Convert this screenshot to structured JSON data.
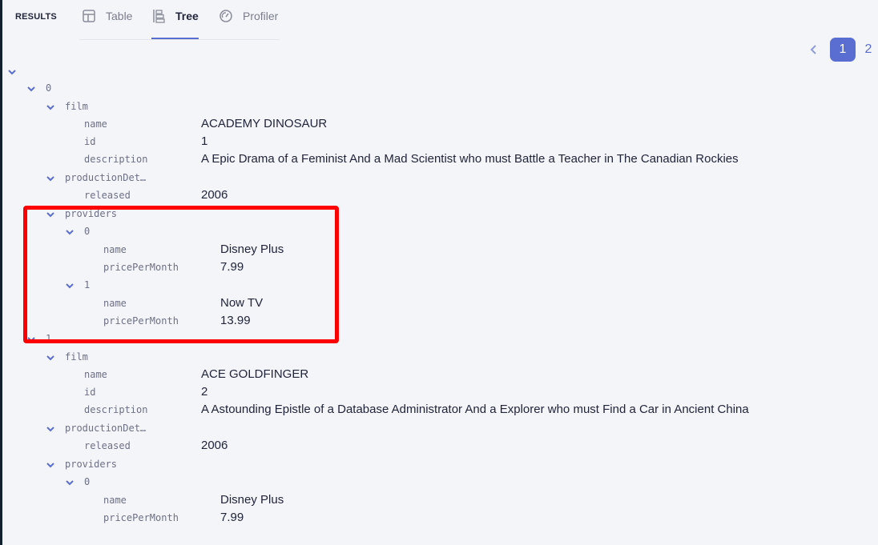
{
  "header": {
    "section_label": "RESULTS",
    "tabs": [
      {
        "label": "Table",
        "icon": "table-icon",
        "active": false
      },
      {
        "label": "Tree",
        "icon": "tree-icon",
        "active": true
      },
      {
        "label": "Profiler",
        "icon": "gauge-icon",
        "active": false
      }
    ]
  },
  "pagination": {
    "prev_icon": "chevron-left-icon",
    "pages": [
      "1",
      "2"
    ],
    "current_page": "1"
  },
  "tree": {
    "root_toggle": "expanded",
    "documents": [
      {
        "index": "0",
        "film_key": "film",
        "film": {
          "name_key": "name",
          "name": "ACADEMY DINOSAUR",
          "id_key": "id",
          "id": "1",
          "description_key": "description",
          "description": "A Epic Drama of a Feminist And a Mad Scientist who must Battle a Teacher in The Canadian Rockies"
        },
        "production_key": "productionDet…",
        "production": {
          "released_key": "released",
          "released": "2006"
        },
        "providers_key": "providers",
        "providers": [
          {
            "index": "0",
            "name_key": "name",
            "name": "Disney Plus",
            "price_key": "pricePerMonth",
            "price": "7.99"
          },
          {
            "index": "1",
            "name_key": "name",
            "name": "Now TV",
            "price_key": "pricePerMonth",
            "price": "13.99"
          }
        ]
      },
      {
        "index": "1",
        "film_key": "film",
        "film": {
          "name_key": "name",
          "name": "ACE GOLDFINGER",
          "id_key": "id",
          "id": "2",
          "description_key": "description",
          "description": "A Astounding Epistle of a Database Administrator And a Explorer who must Find a Car in Ancient China"
        },
        "production_key": "productionDet…",
        "production": {
          "released_key": "released",
          "released": "2006"
        },
        "providers_key": "providers",
        "providers": [
          {
            "index": "0",
            "name_key": "name",
            "name": "Disney Plus",
            "price_key": "pricePerMonth",
            "price": "7.99"
          }
        ]
      }
    ]
  },
  "annotation": {
    "highlight_color": "#ff0000",
    "highlight_target": "providers of document 0"
  },
  "colors": {
    "accent": "#5a6dd0",
    "background": "#f4f5f9",
    "text": "#21253a",
    "key_text": "#6c7084"
  }
}
